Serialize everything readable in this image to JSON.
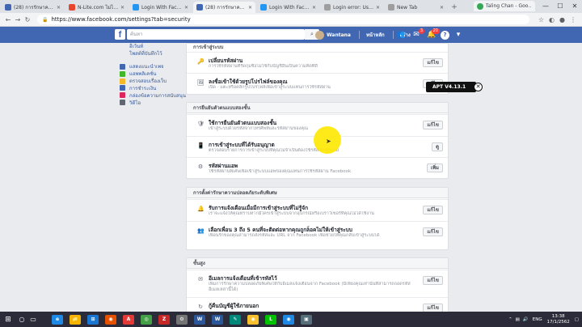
{
  "browser": {
    "tabs": [
      {
        "label": "(28) การรักษาควา…",
        "color": "#4267b2",
        "active": false
      },
      {
        "label": "N-Lite.com ไม่ได้ค…",
        "color": "#e8452c",
        "active": false
      },
      {
        "label": "Login With Facebo…",
        "color": "#2196f3",
        "active": false
      },
      {
        "label": "(28) การรักษาควา…",
        "color": "#4267b2",
        "active": true
      },
      {
        "label": "Login With Facebo…",
        "color": "#2196f3",
        "active": false
      },
      {
        "label": "Login error: User…",
        "color": "#9e9e9e",
        "active": false
      },
      {
        "label": "New Tab",
        "color": "#9e9e9e",
        "active": false
      }
    ],
    "profile_tab": "Taling Chan - Goo…",
    "url": "https://www.facebook.com/settings?tab=security",
    "min": "—",
    "max": "☐",
    "close": "✕"
  },
  "fb": {
    "logo": "f",
    "search_placeholder": "ค้นหา",
    "user_name": "Wantana",
    "home": "หน้าหลัก",
    "create": "สร้าง",
    "badges": {
      "friends": "",
      "messages": "3",
      "notifications": "20"
    }
  },
  "sidebar": {
    "items": [
      {
        "label": "อีเว้นท์",
        "color": "#e0245e"
      },
      {
        "label": "โพสต์ที่บันทึกไว้",
        "color": "#8b5cf6"
      },
      {
        "label": "แสดงแนะนำเพจ",
        "color": "#4267b2"
      },
      {
        "label": "แอพพลิเคชั่น",
        "color": "#42b72a"
      },
      {
        "label": "ตรวจสอบเรื่องเว็บ",
        "color": "#f7b928"
      },
      {
        "label": "การชำระเงิน",
        "color": "#4267b2"
      },
      {
        "label": "กล่องข้อความการสนับสนุน",
        "color": "#e0245e"
      },
      {
        "label": "วิดีโอ",
        "color": "#606770"
      }
    ]
  },
  "sections": [
    {
      "head": "การเข้าสู่ระบบ",
      "rows": [
        {
          "icon": "🔑",
          "title": "เปลี่ยนรหัสผ่าน",
          "desc": "การใช้รหัสผ่านที่รัดกุมซึ่งไม่ใช้กับบัญชีอื่นเป็นความคิดที่ดี",
          "btn": "แก้ไข"
        },
        {
          "icon": "🖼",
          "title": "ลงชื่อเข้าใช้ด้วยรูปโปรไฟล์ของคุณ",
          "desc": "เปิด · แตะหรือคลิกรูปโปรไฟล์เพื่อเข้าสู่ระบบแทนการใช้รหัสผ่าน",
          "btn": "แก้ไข"
        }
      ]
    },
    {
      "head": "การยืนยันตัวตนแบบสองชั้น",
      "rows": [
        {
          "icon": "🛡",
          "title": "ใช้การยืนยันตัวตนแบบสองชั้น",
          "desc": "เข้าสู่ระบบด้วยรหัสจากโทรศัพท์และรหัสผ่านของคุณ",
          "btn": "แก้ไข"
        },
        {
          "icon": "📱",
          "title": "การเข้าสู่ระบบที่ได้รับอนุญาต",
          "desc": "ตรวจสอบรายการการเข้าสู่ระบบที่คุณไม่จำเป็นต้องใช้รหัสเข้าสู่ระบบ",
          "btn": "ดู"
        },
        {
          "icon": "⚙",
          "title": "รหัสผ่านแอพ",
          "desc": "ใช้รหัสผ่านพิเศษเพื่อเข้าสู่ระบบแอพของคุณแทนการใช้รหัสผ่าน Facebook",
          "btn": "เพิ่ม"
        }
      ]
    },
    {
      "head": "การตั้งค่ารักษาความปลอดภัยระดับพิเศษ",
      "rows": [
        {
          "icon": "🔔",
          "title": "รับการแจ้งเตือนเมื่อมีการเข้าสู่ระบบที่ไม่รู้จัก",
          "desc": "เราจะแจ้งให้คุณทราบหากมีใครเข้าสู่ระบบจากอุปกรณ์หรือเบราว์เซอร์ที่คุณไม่ได้ใช้งาน",
          "btn": "แก้ไข"
        },
        {
          "icon": "👥",
          "title": "เลือกเพื่อน 3 ถึง 5 คนที่จะติดต่อหากคุณถูกล็อคไม่ให้เข้าสู่ระบบ",
          "desc": "เพื่อนรักของคุณสามารถส่งรหัสและ URL จาก Facebook เพื่อช่วยให้คุณกลับเข้าสู่ระบบได้",
          "btn": "แก้ไข"
        }
      ]
    },
    {
      "head": "ขั้นสูง",
      "rows": [
        {
          "icon": "✉",
          "title": "อีเมลการแจ้งเตือนที่เข้ารหัสไว้",
          "desc": "เพิ่มการรักษาความปลอดภัยพิเศษให้กับอีเมลแจ้งเตือนจาก Facebook (มีเพียงคุณเท่านั้นที่สามารถถอดรหัสอีเมลเหล่านี้ได้)",
          "btn": "แก้ไข"
        },
        {
          "icon": "↻",
          "title": "กู้คืนบัญชีผู้ใช้ภายนอก",
          "desc": "",
          "btn": "แก้ไข"
        }
      ]
    }
  ],
  "overlay": {
    "apt_label": "APT V4.13.1",
    "close": "✕"
  },
  "taskbar": {
    "time": "13:38",
    "date": "17/1/2562",
    "lang": "ENG",
    "apps": [
      {
        "label": "e",
        "color": "#1e88e5"
      },
      {
        "label": "📁",
        "color": "#f4b400"
      },
      {
        "label": "⊞",
        "color": "#1976d2"
      },
      {
        "label": "◉",
        "color": "#e65100"
      },
      {
        "label": "A",
        "color": "#e53935"
      },
      {
        "label": "◎",
        "color": "#43a047"
      },
      {
        "label": "Z",
        "color": "#c62828"
      },
      {
        "label": "⚙",
        "color": "#757575"
      },
      {
        "label": "W",
        "color": "#2b579a"
      },
      {
        "label": "W",
        "color": "#2b579a"
      },
      {
        "label": "✎",
        "color": "#00897b"
      },
      {
        "label": "◉",
        "color": "#fbc02d"
      },
      {
        "label": "L",
        "color": "#00c300"
      },
      {
        "label": "◉",
        "color": "#1e88e5"
      },
      {
        "label": "▣",
        "color": "#546e7a"
      }
    ]
  }
}
